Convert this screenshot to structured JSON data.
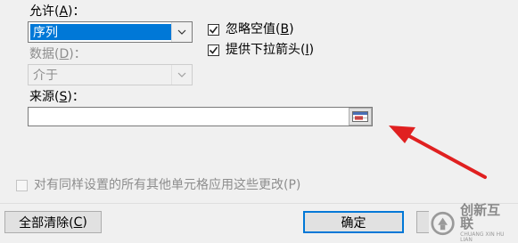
{
  "allow": {
    "label_prefix": "允许(",
    "mnemonic": "A",
    "label_suffix": ")：",
    "value": "序列"
  },
  "ignore_blank": {
    "label_prefix": "忽略空值(",
    "mnemonic": "B",
    "label_suffix": ")",
    "checked": true
  },
  "dropdown": {
    "label_prefix": "提供下拉箭头(",
    "mnemonic": "I",
    "label_suffix": ")",
    "checked": true
  },
  "data": {
    "label_prefix": "数据(",
    "mnemonic": "D",
    "label_suffix": ")：",
    "value": "介于"
  },
  "source": {
    "label_prefix": "来源(",
    "mnemonic": "S",
    "label_suffix": ")：",
    "value": ""
  },
  "apply_all": {
    "label": "对有同样设置的所有其他单元格应用这些更改(P)",
    "checked": false
  },
  "buttons": {
    "clear_prefix": "全部清除(",
    "clear_mnemonic": "C",
    "clear_suffix": ")",
    "ok": "确定"
  },
  "watermark": {
    "main": "创新互联",
    "sub": "CHUANG XIN HU LIAN"
  },
  "colors": {
    "arrow": "#e02020",
    "selection": "#0078d7",
    "logo": "#9a9a9a"
  },
  "icons": [
    "chevron-down-icon",
    "checkmark-icon",
    "range-select-icon",
    "red-arrow-annotation",
    "logo-icon"
  ]
}
